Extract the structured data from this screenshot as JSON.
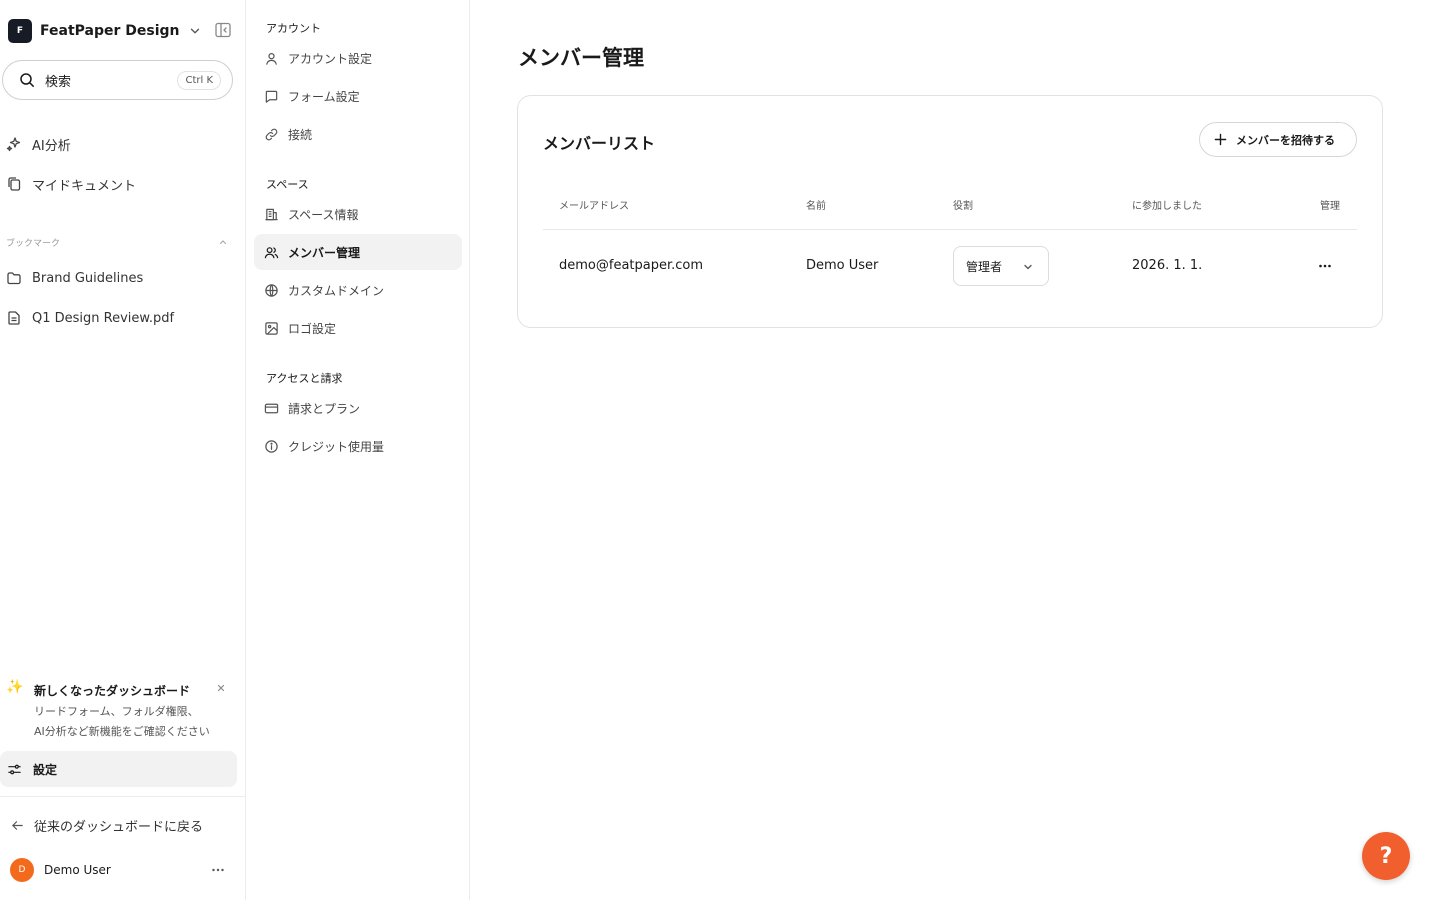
{
  "sidebar": {
    "workspace": {
      "logo_letter": "F",
      "name": "FeatPaper Design"
    },
    "search": {
      "label": "検索",
      "shortcut": "Ctrl K"
    },
    "items": [
      {
        "label": "AI分析",
        "icon": "sparkles-icon"
      },
      {
        "label": "マイドキュメント",
        "icon": "documents-icon"
      }
    ],
    "bookmarks": {
      "label": "ブックマーク",
      "items": [
        {
          "label": "Brand Guidelines",
          "icon": "folder-icon"
        },
        {
          "label": "Q1 Design Review.pdf",
          "icon": "file-icon"
        }
      ]
    },
    "notice": {
      "title": "新しくなったダッシュボード",
      "line1": "リードフォーム、フォルダ権限、",
      "line2": "AI分析など新機能をご確認ください"
    },
    "settings_label": "設定",
    "back_label": "従来のダッシュボードに戻る",
    "user": {
      "initial": "D",
      "name": "Demo User"
    }
  },
  "settings_nav": {
    "sections": [
      {
        "label": "アカウント",
        "items": [
          {
            "label": "アカウント設定",
            "icon": "user-icon"
          },
          {
            "label": "フォーム設定",
            "icon": "message-square-icon"
          },
          {
            "label": "接続",
            "icon": "link-icon"
          }
        ]
      },
      {
        "label": "スペース",
        "items": [
          {
            "label": "スペース情報",
            "icon": "building-icon"
          },
          {
            "label": "メンバー管理",
            "icon": "users-icon",
            "active": true
          },
          {
            "label": "カスタムドメイン",
            "icon": "globe-icon"
          },
          {
            "label": "ロゴ設定",
            "icon": "image-icon"
          }
        ]
      },
      {
        "label": "アクセスと請求",
        "items": [
          {
            "label": "請求とプラン",
            "icon": "credit-card-icon"
          },
          {
            "label": "クレジット使用量",
            "icon": "info-icon"
          }
        ]
      }
    ]
  },
  "main": {
    "title": "メンバー管理",
    "card": {
      "title": "メンバーリスト",
      "invite_label": "メンバーを招待する",
      "columns": [
        "メールアドレス",
        "名前",
        "役割",
        "に参加しました",
        "管理"
      ],
      "rows": [
        {
          "email": "demo@featpaper.com",
          "name": "Demo User",
          "role": "管理者",
          "joined": "2026. 1. 1."
        }
      ]
    }
  },
  "help": {
    "label": "?"
  },
  "colors": {
    "accent": "#f25f2e",
    "avatar": "#f46a1d",
    "logo_bg": "#161b26"
  }
}
